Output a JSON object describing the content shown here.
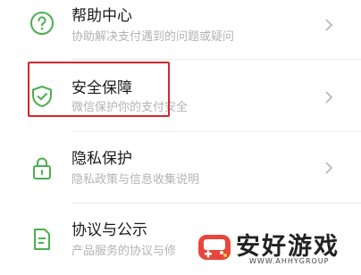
{
  "items": [
    {
      "title": "帮助中心",
      "subtitle": "协助解决支付遇到的问题或疑问",
      "icon": "help-circle-icon"
    },
    {
      "title": "安全保障",
      "subtitle": "微信保护你的支付安全",
      "icon": "shield-check-icon"
    },
    {
      "title": "隐私保护",
      "subtitle": "隐私政策与信息收集说明",
      "icon": "lock-icon"
    },
    {
      "title": "协议与公示",
      "subtitle": "产品服务的协议与修",
      "icon": "document-icon"
    }
  ],
  "watermark": {
    "text": "安好游戏",
    "sub": "WWW.AHHYGROUP"
  },
  "colors": {
    "icon": "#4caf50",
    "highlight": "#d8262b",
    "chevron": "#b8b8b8"
  }
}
